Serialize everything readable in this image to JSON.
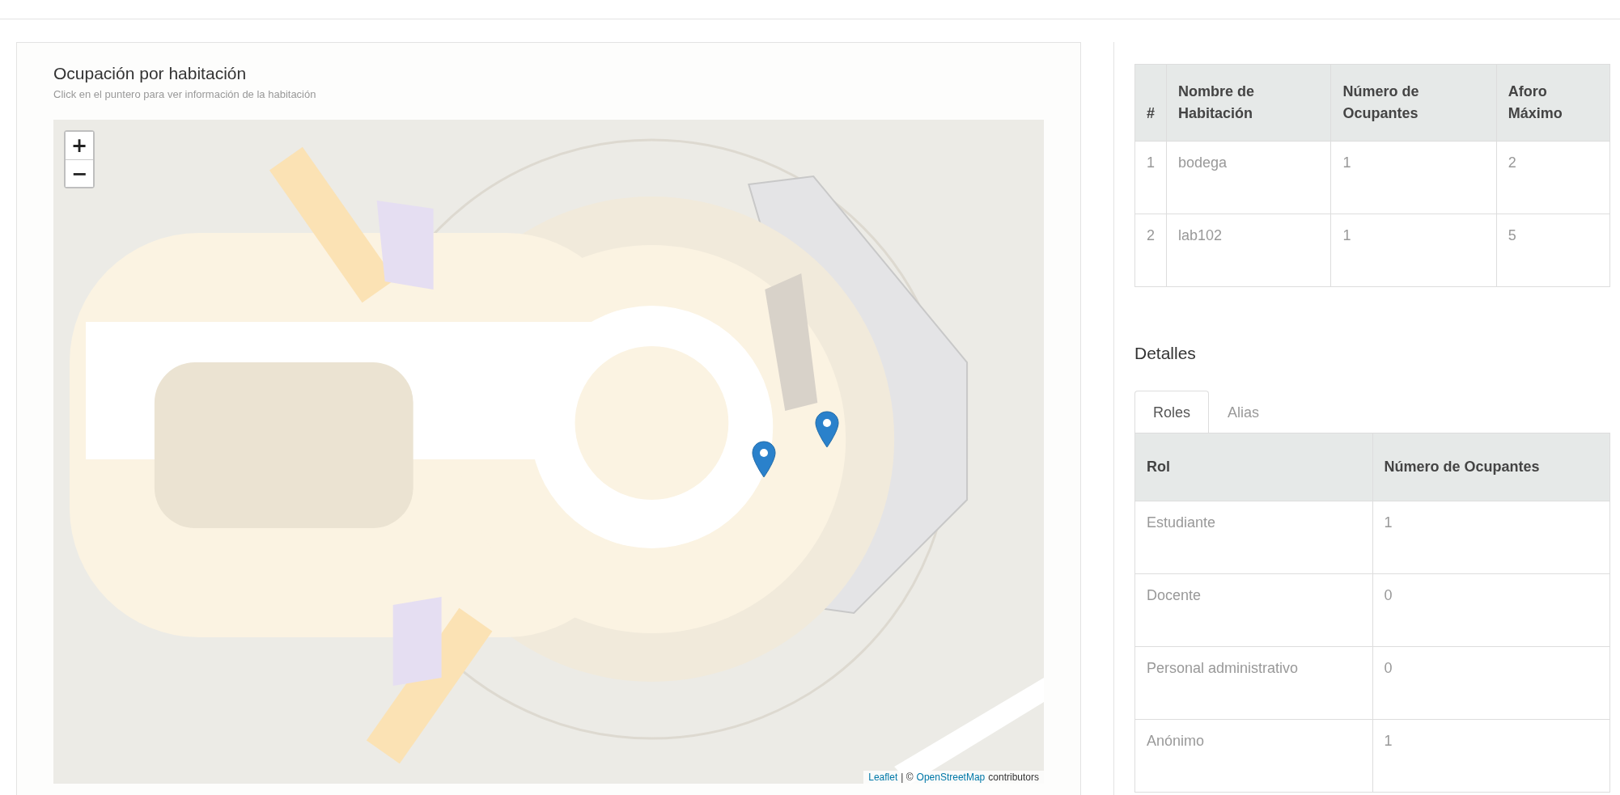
{
  "map_card": {
    "title": "Ocupación por habitación",
    "subtitle": "Click en el puntero para ver información de la habitación",
    "map": {
      "kind": "picture",
      "zoom_in": "+",
      "zoom_out": "−",
      "attribution": {
        "links": [
          "Leaflet",
          "OpenStreetMap"
        ],
        "separator": "| ©",
        "suffix": "contributors"
      }
    }
  },
  "rooms_table": {
    "columns": [
      "#",
      "Nombre de Habitación",
      "Número de Ocupantes",
      "Aforo Máximo"
    ],
    "rows": [
      [
        "1",
        "bodega",
        "1",
        "2"
      ],
      [
        "2",
        "lab102",
        "1",
        "5"
      ]
    ]
  },
  "details": {
    "title": "Detalles",
    "tabs": [
      {
        "label": "Roles",
        "selected": true
      },
      {
        "label": "Alias",
        "selected": false
      }
    ],
    "columns": [
      "Rol",
      "Número de Ocupantes"
    ],
    "rows": [
      [
        "Estudiante",
        "1"
      ],
      [
        "Docente",
        "0"
      ],
      [
        "Personal administrativo",
        "0"
      ],
      [
        "Anónimo",
        "1"
      ]
    ]
  }
}
